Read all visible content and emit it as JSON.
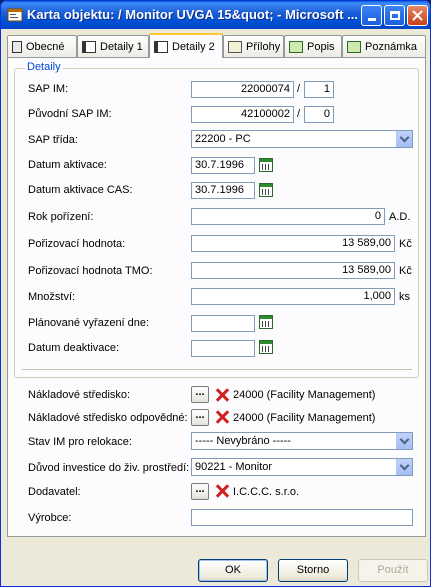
{
  "window": {
    "title": "Karta objektu: / Monitor UVGA 15&quot; - Microsoft ..."
  },
  "tabs": [
    {
      "label": "Obecné",
      "icon": "tab-page-icon"
    },
    {
      "label": "Detaily 1",
      "icon": "tab-details-icon"
    },
    {
      "label": "Detaily 2",
      "icon": "tab-details-icon"
    },
    {
      "label": "Přílohy",
      "icon": "attachments-icon"
    },
    {
      "label": "Popis",
      "icon": "description-icon"
    },
    {
      "label": "Poznámka",
      "icon": "note-icon"
    }
  ],
  "active_tab": "Detaily 2",
  "group": {
    "label": "Detaily"
  },
  "fields": {
    "sap_im": {
      "label": "SAP IM:",
      "value": "22000074",
      "sub": "1"
    },
    "puvodni_sap_im": {
      "label": "Původní SAP IM:",
      "value": "42100002",
      "sub": "0"
    },
    "sap_trida": {
      "label": "SAP třída:",
      "value": "22200 - PC"
    },
    "datum_aktivace": {
      "label": "Datum aktivace:",
      "value": "30.7.1996"
    },
    "datum_aktivace_cas": {
      "label": "Datum aktivace CAS:",
      "value": "30.7.1996"
    },
    "rok_porizeni": {
      "label": "Rok pořízení:",
      "value": "0",
      "unit": "A.D."
    },
    "porizovaci_hodnota": {
      "label": "Pořizovací hodnota:",
      "value": "13 589,00",
      "unit": "Kč"
    },
    "porizovaci_hodnota_tmo": {
      "label": "Pořizovací hodnota TMO:",
      "value": "13 589,00",
      "unit": "Kč"
    },
    "mnozstvi": {
      "label": "Množství:",
      "value": "1,000",
      "unit": "ks"
    },
    "planovane_vyrazeni": {
      "label": "Plánované vyřazení dne:",
      "value": ""
    },
    "datum_deaktivace": {
      "label": "Datum deaktivace:",
      "value": ""
    },
    "nakladove_stredisko": {
      "label": "Nákladové středisko:",
      "value": "24000 (Facility Management)"
    },
    "nakladove_stredisko_odp": {
      "label": "Nákladové středisko odpovědné:",
      "value": "24000 (Facility Management)"
    },
    "stav_im": {
      "label": "Stav IM pro relokace:",
      "value": "----- Nevybráno -----"
    },
    "duvod_investice": {
      "label": "Důvod investice do živ. prostředí:",
      "value": "90221 - Monitor"
    },
    "dodavatel": {
      "label": "Dodavatel:",
      "value": "I.C.C.C. s.r.o."
    },
    "vyrobce": {
      "label": "Výrobce:",
      "value": ""
    }
  },
  "buttons": {
    "ok": "OK",
    "storno": "Storno",
    "pouzit": "Použít",
    "browse": "..."
  },
  "colors": {
    "accent": "#0046d5",
    "title_bar": "#0052d6",
    "clear_icon": "#d21f1f"
  }
}
